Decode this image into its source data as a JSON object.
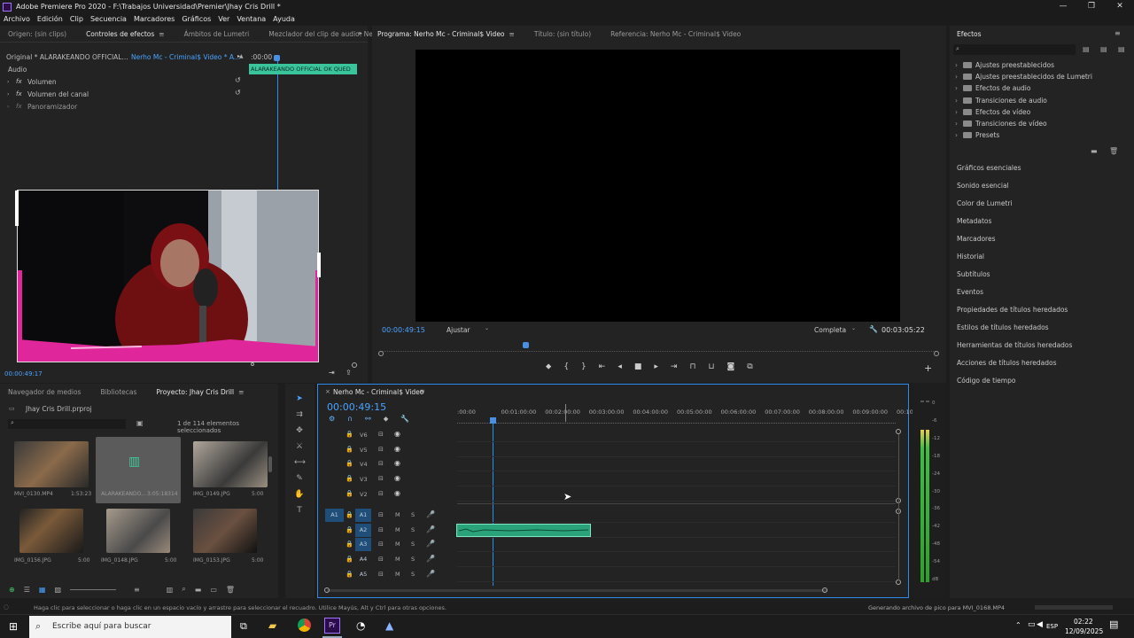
{
  "window": {
    "title": "Adobe Premiere Pro 2020 - F:\\Trabajos Universidad\\Premier\\Jhay Cris Drill *",
    "controls": [
      "—",
      "❐",
      "✕"
    ]
  },
  "menu": [
    "Archivo",
    "Edición",
    "Clip",
    "Secuencia",
    "Marcadores",
    "Gráficos",
    "Ver",
    "Ventana",
    "Ayuda"
  ],
  "source_panel": {
    "tabs": [
      "Origen: (sin clips)",
      "Controles de efectos",
      "Ámbitos de Lumetri",
      "Mezclador del clip de audio: Ner"
    ],
    "breadcrumb_master": "Original * ALARAKEANDO OFFICIAL...",
    "breadcrumb_sequence": "Nerho Mc - Criminal$ Video * A...",
    "timecode_start": ":00:00",
    "clip_label": "ALARAKEANDO OFFICIAL OK QUED",
    "section": "Audio",
    "effects": [
      {
        "fx": "fx",
        "name": "Volumen"
      },
      {
        "fx": "fx",
        "name": "Volumen del canal"
      },
      {
        "fx": "fx",
        "name": "Panoramizador"
      }
    ],
    "timecode": "00:00:49:17"
  },
  "program_panel": {
    "tabs": [
      "Programa: Nerho Mc - Criminal$ Video",
      "Título: (sin título)",
      "Referencia: Nerho Mc - Criminal$ Video"
    ],
    "timecode": "00:00:49:15",
    "fit": "Ajustar",
    "quality": "Completa",
    "duration": "00:03:05:22"
  },
  "effects_panel": {
    "title": "Efectos",
    "folders": [
      "Ajustes preestablecidos",
      "Ajustes preestablecidos de Lumetri",
      "Efectos de audio",
      "Transiciones de audio",
      "Efectos de vídeo",
      "Transiciones de vídeo",
      "Presets"
    ],
    "side_panels": [
      "Gráficos esenciales",
      "Sonido esencial",
      "Color de Lumetri",
      "Metadatos",
      "Marcadores",
      "Historial",
      "Subtítulos",
      "Eventos",
      "Propiedades de títulos heredados",
      "Estilos de títulos heredados",
      "Herramientas de títulos heredados",
      "Acciones de títulos heredados",
      "Código de tiempo"
    ]
  },
  "project_panel": {
    "tabs": [
      "Navegador de medios",
      "Bibliotecas",
      "Proyecto: Jhay Cris Drill"
    ],
    "file": "Jhay Cris Drill.prproj",
    "selection": "1 de 114 elementos seleccionados",
    "items": [
      {
        "name": "MVI_0130.MP4",
        "duration": "1:53:23"
      },
      {
        "name": "ALARAKEANDO...",
        "duration": "3:05:18314"
      },
      {
        "name": "IMG_0149.JPG",
        "duration": "5:00"
      },
      {
        "name": "IMG_0156.JPG",
        "duration": "5:00"
      },
      {
        "name": "IMG_0148.JPG",
        "duration": "5:00"
      },
      {
        "name": "IMG_0153.JPG",
        "duration": "5:00"
      }
    ]
  },
  "timeline": {
    "tab": "Nerho Mc - Criminal$ Video",
    "timecode": "00:00:49:15",
    "ruler": [
      ":00:00",
      "00:01:00:00",
      "00:02:00:00",
      "00:03:00:00",
      "00:04:00:00",
      "00:05:00:00",
      "00:06:00:00",
      "00:07:00:00",
      "00:08:00:00",
      "00:09:00:00",
      "00:10"
    ],
    "video_tracks": [
      "V6",
      "V5",
      "V4",
      "V3",
      "V2"
    ],
    "audio_tracks": [
      "A1",
      "A2",
      "A3",
      "A4",
      "A5"
    ],
    "source_patch": "A1",
    "mute": "M",
    "solo": "S"
  },
  "meter": {
    "labels": [
      "0",
      "-6",
      "-12",
      "-18",
      "-24",
      "-30",
      "-36",
      "-42",
      "-48",
      "-54",
      "dB"
    ]
  },
  "status": {
    "left": "Haga clic para seleccionar o haga clic en un espacio vacío y arrastre para seleccionar el recuadro. Utilice Mayús, Alt y Ctrl para otras opciones.",
    "right": "Generando archivo de pico para MVI_0168.MP4"
  },
  "taskbar": {
    "search": "Escribe aquí para buscar",
    "lang": "ESP",
    "time": "02:22",
    "date": "12/09/2025"
  },
  "colors": {
    "accent": "#2d8ceb",
    "clip_green": "#2aa37a",
    "pink": "#e0269b",
    "panel_bg": "#232323"
  }
}
